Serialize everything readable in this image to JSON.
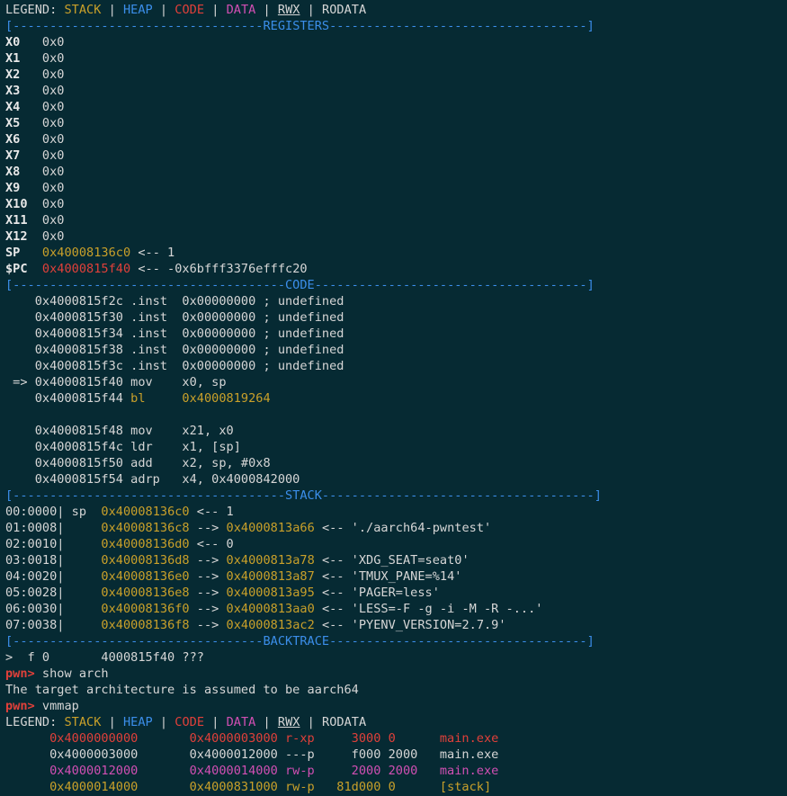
{
  "legend": "LEGEND: STACK | HEAP | CODE | DATA | RWX | RODATA",
  "lines": [
    [
      [
        "LEGEND: ",
        "white"
      ],
      [
        "STACK",
        "yellow"
      ],
      [
        " | ",
        "white"
      ],
      [
        "HEAP",
        "blue"
      ],
      [
        " | ",
        "white"
      ],
      [
        "CODE",
        "red"
      ],
      [
        " | ",
        "white"
      ],
      [
        "DATA",
        "magenta"
      ],
      [
        " | ",
        "white"
      ],
      [
        "RWX",
        "under"
      ],
      [
        " | RODATA",
        "white"
      ]
    ],
    [
      [
        "[----------------------------------",
        "blue"
      ],
      [
        "REGISTERS",
        "blue"
      ],
      [
        "-----------------------------------]",
        "blue"
      ]
    ],
    [
      [
        "X0   ",
        "bold"
      ],
      [
        "0x0",
        "white"
      ]
    ],
    [
      [
        "X1   ",
        "bold"
      ],
      [
        "0x0",
        "white"
      ]
    ],
    [
      [
        "X2   ",
        "bold"
      ],
      [
        "0x0",
        "white"
      ]
    ],
    [
      [
        "X3   ",
        "bold"
      ],
      [
        "0x0",
        "white"
      ]
    ],
    [
      [
        "X4   ",
        "bold"
      ],
      [
        "0x0",
        "white"
      ]
    ],
    [
      [
        "X5   ",
        "bold"
      ],
      [
        "0x0",
        "white"
      ]
    ],
    [
      [
        "X6   ",
        "bold"
      ],
      [
        "0x0",
        "white"
      ]
    ],
    [
      [
        "X7   ",
        "bold"
      ],
      [
        "0x0",
        "white"
      ]
    ],
    [
      [
        "X8   ",
        "bold"
      ],
      [
        "0x0",
        "white"
      ]
    ],
    [
      [
        "X9   ",
        "bold"
      ],
      [
        "0x0",
        "white"
      ]
    ],
    [
      [
        "X10  ",
        "bold"
      ],
      [
        "0x0",
        "white"
      ]
    ],
    [
      [
        "X11  ",
        "bold"
      ],
      [
        "0x0",
        "white"
      ]
    ],
    [
      [
        "X12  ",
        "bold"
      ],
      [
        "0x0",
        "white"
      ]
    ],
    [
      [
        "SP   ",
        "bold"
      ],
      [
        "0x40008136c0",
        "yellow"
      ],
      [
        " <-- 1",
        "white"
      ]
    ],
    [
      [
        "$PC  ",
        "bold"
      ],
      [
        "0x4000815f40",
        "red"
      ],
      [
        " <-- -0x6bfff3376efffc20",
        "white"
      ]
    ],
    [
      [
        "[-------------------------------------",
        "blue"
      ],
      [
        "CODE",
        "blue"
      ],
      [
        "-------------------------------------]",
        "blue"
      ]
    ],
    [
      [
        "    0x4000815f2c .inst  0x00000000 ; undefined",
        "white"
      ]
    ],
    [
      [
        "    0x4000815f30 .inst  0x00000000 ; undefined",
        "white"
      ]
    ],
    [
      [
        "    0x4000815f34 .inst  0x00000000 ; undefined",
        "white"
      ]
    ],
    [
      [
        "    0x4000815f38 .inst  0x00000000 ; undefined",
        "white"
      ]
    ],
    [
      [
        "    0x4000815f3c .inst  0x00000000 ; undefined",
        "white"
      ]
    ],
    [
      [
        " => 0x4000815f40 mov    x0, sp",
        "white"
      ]
    ],
    [
      [
        "    0x4000815f44 ",
        "white"
      ],
      [
        "bl     0x4000819264",
        "yellow"
      ]
    ],
    [
      [
        "",
        "white"
      ]
    ],
    [
      [
        "    0x4000815f48 mov    x21, x0",
        "white"
      ]
    ],
    [
      [
        "    0x4000815f4c ldr    x1, [sp]",
        "white"
      ]
    ],
    [
      [
        "    0x4000815f50 add    x2, sp, #0x8",
        "white"
      ]
    ],
    [
      [
        "    0x4000815f54 adrp   x4, 0x4000842000",
        "white"
      ]
    ],
    [
      [
        "[-------------------------------------",
        "blue"
      ],
      [
        "STACK",
        "blue"
      ],
      [
        "-------------------------------------]",
        "blue"
      ]
    ],
    [
      [
        "00:0000| sp  ",
        "white"
      ],
      [
        "0x40008136c0",
        "yellow"
      ],
      [
        " <-- 1",
        "white"
      ]
    ],
    [
      [
        "01:0008|     ",
        "white"
      ],
      [
        "0x40008136c8",
        "yellow"
      ],
      [
        " --> ",
        "white"
      ],
      [
        "0x4000813a66",
        "yellow"
      ],
      [
        " <-- './aarch64-pwntest'",
        "white"
      ]
    ],
    [
      [
        "02:0010|     ",
        "white"
      ],
      [
        "0x40008136d0",
        "yellow"
      ],
      [
        " <-- 0",
        "white"
      ]
    ],
    [
      [
        "03:0018|     ",
        "white"
      ],
      [
        "0x40008136d8",
        "yellow"
      ],
      [
        " --> ",
        "white"
      ],
      [
        "0x4000813a78",
        "yellow"
      ],
      [
        " <-- 'XDG_SEAT=seat0'",
        "white"
      ]
    ],
    [
      [
        "04:0020|     ",
        "white"
      ],
      [
        "0x40008136e0",
        "yellow"
      ],
      [
        " --> ",
        "white"
      ],
      [
        "0x4000813a87",
        "yellow"
      ],
      [
        " <-- 'TMUX_PANE=%14'",
        "white"
      ]
    ],
    [
      [
        "05:0028|     ",
        "white"
      ],
      [
        "0x40008136e8",
        "yellow"
      ],
      [
        " --> ",
        "white"
      ],
      [
        "0x4000813a95",
        "yellow"
      ],
      [
        " <-- 'PAGER=less'",
        "white"
      ]
    ],
    [
      [
        "06:0030|     ",
        "white"
      ],
      [
        "0x40008136f0",
        "yellow"
      ],
      [
        " --> ",
        "white"
      ],
      [
        "0x4000813aa0",
        "yellow"
      ],
      [
        " <-- 'LESS=-F -g -i -M -R -...'",
        "white"
      ]
    ],
    [
      [
        "07:0038|     ",
        "white"
      ],
      [
        "0x40008136f8",
        "yellow"
      ],
      [
        " --> ",
        "white"
      ],
      [
        "0x4000813ac2",
        "yellow"
      ],
      [
        " <-- 'PYENV_VERSION=2.7.9'",
        "white"
      ]
    ],
    [
      [
        "[----------------------------------",
        "blue"
      ],
      [
        "BACKTRACE",
        "blue"
      ],
      [
        "-----------------------------------]",
        "blue"
      ]
    ],
    [
      [
        ">  f 0       4000815f40 ???",
        "white"
      ]
    ],
    [
      [
        "pwn> ",
        "prompt"
      ],
      [
        "show arch",
        "white"
      ]
    ],
    [
      [
        "The target architecture is assumed to be aarch64",
        "white"
      ]
    ],
    [
      [
        "pwn> ",
        "prompt"
      ],
      [
        "vmmap",
        "white"
      ]
    ],
    [
      [
        "LEGEND: ",
        "white"
      ],
      [
        "STACK",
        "yellow"
      ],
      [
        " | ",
        "white"
      ],
      [
        "HEAP",
        "blue"
      ],
      [
        " | ",
        "white"
      ],
      [
        "CODE",
        "red"
      ],
      [
        " | ",
        "white"
      ],
      [
        "DATA",
        "magenta"
      ],
      [
        " | ",
        "white"
      ],
      [
        "RWX",
        "under"
      ],
      [
        " | RODATA",
        "white"
      ]
    ],
    [
      [
        "      0x4000000000       0x4000003000 r-xp     3000 0      main.exe",
        "red"
      ]
    ],
    [
      [
        "      0x4000003000       0x4000012000 ---p     f000 2000   main.exe",
        "white"
      ]
    ],
    [
      [
        "      0x4000012000       0x4000014000 rw-p     2000 2000   main.exe",
        "magenta"
      ]
    ],
    [
      [
        "      0x4000014000       0x4000831000 rw-p   81d000 0      [stack]",
        "yellow"
      ]
    ]
  ]
}
